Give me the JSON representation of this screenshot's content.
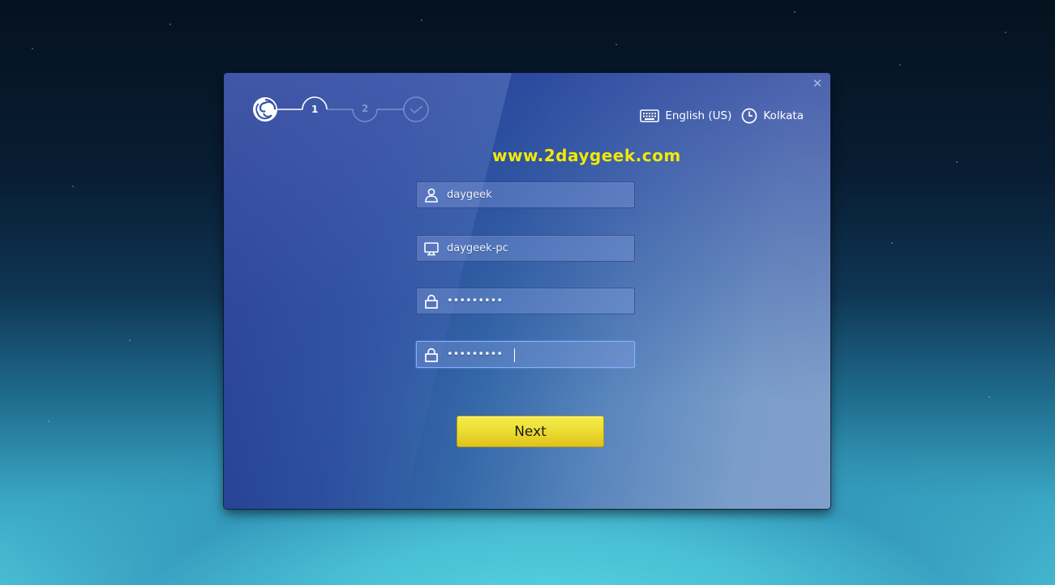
{
  "wizard": {
    "steps": [
      {
        "label": "1",
        "state": "current"
      },
      {
        "label": "2",
        "state": "pending"
      },
      {
        "label": "",
        "state": "final",
        "icon": "check-icon"
      }
    ],
    "close_icon": "close-icon",
    "logo_icon": "deepin-logo-icon"
  },
  "header": {
    "keyboard_layout": "English (US)",
    "keyboard_icon": "keyboard-icon",
    "timezone": "Kolkata",
    "timezone_icon": "clock-icon"
  },
  "watermark": "www.2daygeek.com",
  "form": {
    "username": {
      "value": "daygeek",
      "icon": "user-icon"
    },
    "computer_name": {
      "value": "daygeek-pc",
      "icon": "computer-icon"
    },
    "password": {
      "value": "•••••••••",
      "icon": "lock-icon"
    },
    "confirm_password": {
      "value": "•••••••••",
      "icon": "lock-icon",
      "focused": true
    }
  },
  "actions": {
    "next_label": "Next"
  },
  "colors": {
    "accent_button": "#ece13a",
    "watermark": "#f3e807",
    "focus_border": "#7fb2ff"
  }
}
